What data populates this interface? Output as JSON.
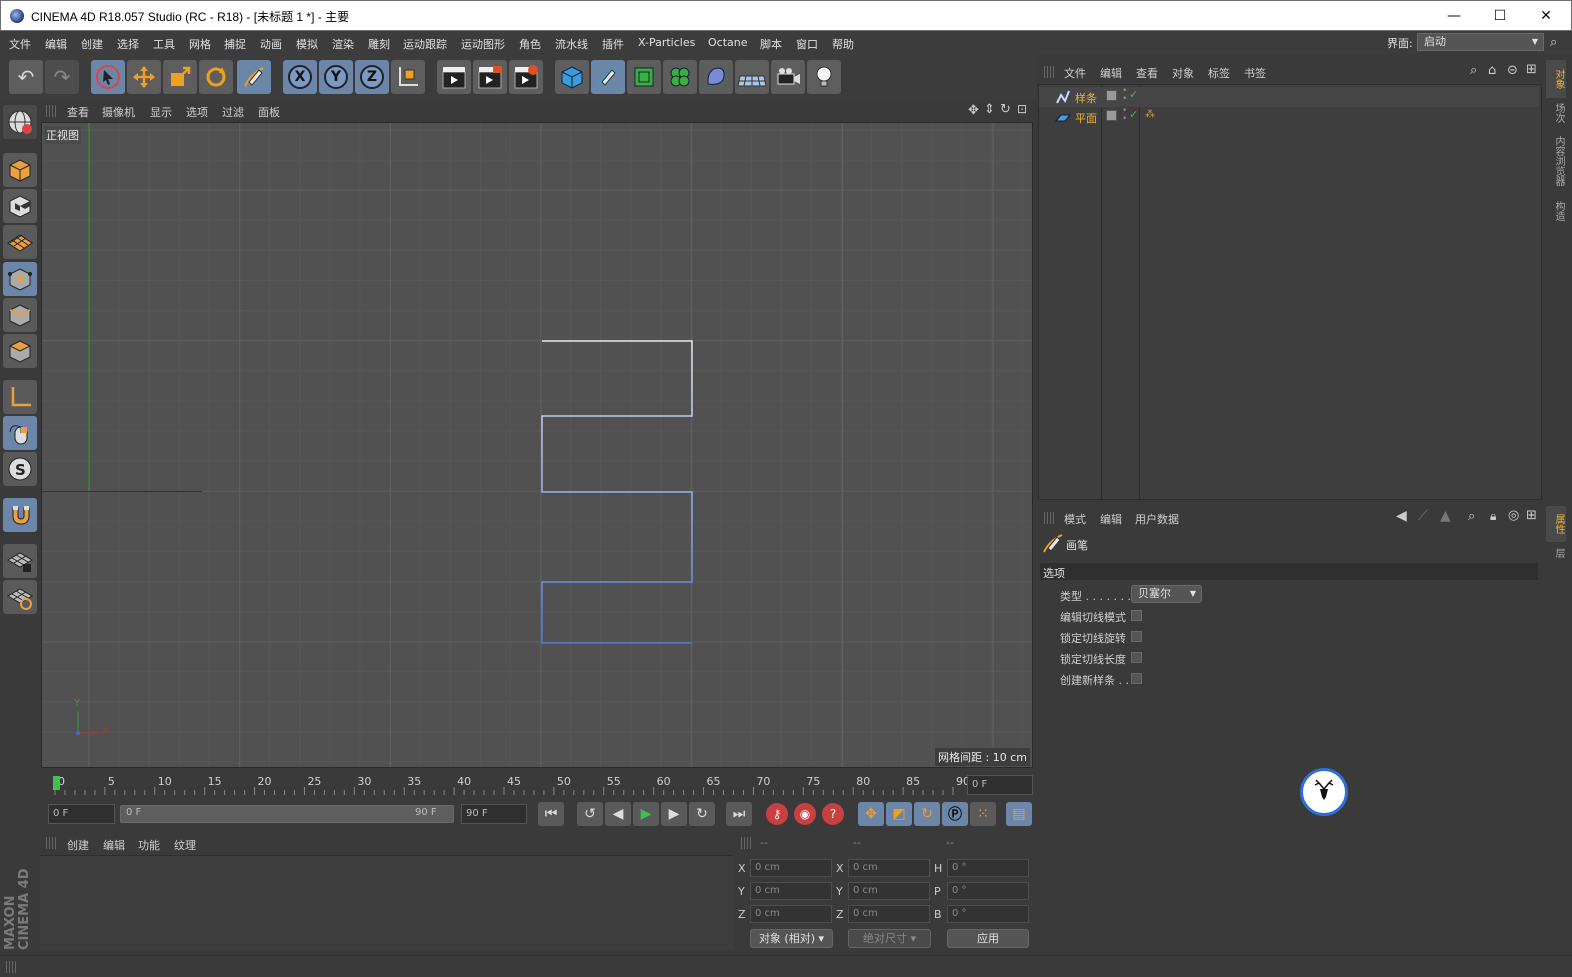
{
  "window": {
    "title": "CINEMA 4D R18.057 Studio (RC - R18) - [未标题 1 *] - 主要",
    "minimize_glyph": "—",
    "maximize_glyph": "☐",
    "close_glyph": "✕"
  },
  "menubar": {
    "items": [
      "文件",
      "编辑",
      "创建",
      "选择",
      "工具",
      "网格",
      "捕捉",
      "动画",
      "模拟",
      "渲染",
      "雕刻",
      "运动跟踪",
      "运动图形",
      "角色",
      "流水线",
      "插件",
      "X-Particles",
      "Octane",
      "脚本",
      "窗口",
      "帮助"
    ],
    "layout_label": "界面:",
    "layout_value": "启动"
  },
  "toolbar": {
    "x_label": "X",
    "y_label": "Y",
    "z_label": "Z"
  },
  "viewport": {
    "menu": [
      "查看",
      "摄像机",
      "显示",
      "选项",
      "过滤",
      "面板"
    ],
    "view_name": "正视图",
    "grid_spacing": "网格间距 : 10 cm",
    "axis_y": "Y",
    "axis_x": "X",
    "colors": {
      "background": "#515151",
      "grid": "#5e5e5e",
      "x_axis": "#c0302a",
      "y_axis": "#3a9a3a",
      "spline": "#e8e8f0",
      "spline_end": "#4a7adf"
    }
  },
  "timeline": {
    "ticks": [
      "0",
      "5",
      "10",
      "15",
      "20",
      "25",
      "30",
      "35",
      "40",
      "45",
      "50",
      "55",
      "60",
      "65",
      "70",
      "75",
      "80",
      "85",
      "90"
    ],
    "current_frame": "0 F",
    "start_frame": "0 F",
    "range_start": "0 F",
    "range_end": "90 F",
    "end_frame": "90 F"
  },
  "material_manager": {
    "menu": [
      "创建",
      "编辑",
      "功能",
      "纹理"
    ]
  },
  "coordinates": {
    "headers": [
      "--",
      "--",
      "--"
    ],
    "rows": [
      {
        "axis": "X",
        "pos": "0 cm",
        "axis2": "X",
        "size": "0 cm",
        "rot_label": "H",
        "rot": "0 °"
      },
      {
        "axis": "Y",
        "pos": "0 cm",
        "axis2": "Y",
        "size": "0 cm",
        "rot_label": "P",
        "rot": "0 °"
      },
      {
        "axis": "Z",
        "pos": "0 cm",
        "axis2": "Z",
        "size": "0 cm",
        "rot_label": "B",
        "rot": "0 °"
      }
    ],
    "mode": "对象 (相对)",
    "size_mode": "绝对尺寸",
    "apply": "应用"
  },
  "object_manager": {
    "menu": [
      "文件",
      "编辑",
      "查看",
      "对象",
      "标签",
      "书签"
    ],
    "objects": [
      {
        "name": "样条"
      },
      {
        "name": "平面"
      }
    ]
  },
  "attribute_manager": {
    "menu": [
      "模式",
      "编辑",
      "用户数据"
    ],
    "tool_name": "画笔",
    "section": "选项",
    "type_label": "类型 . . . . . . .",
    "type_value": "贝塞尔",
    "options": [
      "编辑切线模式",
      "锁定切线旋转",
      "锁定切线长度",
      "创建新样条 . ."
    ]
  },
  "right_tabs": {
    "top": [
      "对象",
      "场次",
      "内容浏览器",
      "构造"
    ],
    "bottom": [
      "属性",
      "层"
    ]
  },
  "branding": {
    "logo_text": "MAXON CINEMA 4D"
  }
}
